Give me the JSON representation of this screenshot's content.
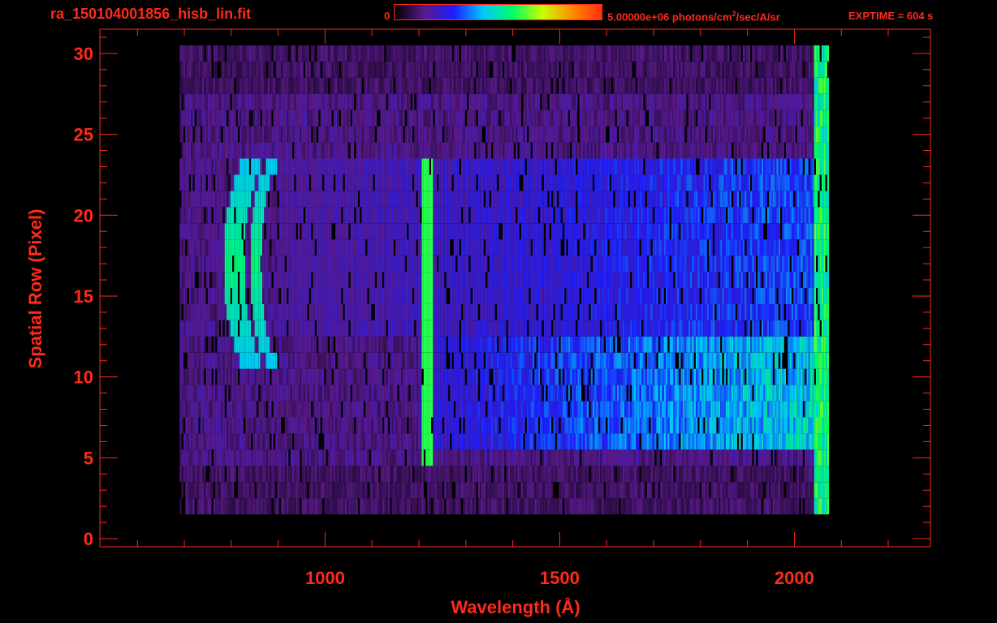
{
  "header": {
    "filename": "ra_150104001856_hisb_lin.fit",
    "colorbar_min_label": "0",
    "colorbar_max_label": "5.00000e+06 photons/cm",
    "colorbar_unit_exp": "2",
    "colorbar_unit_tail": "/sec/A/sr",
    "exptime_label": "EXPTIME = 604 s"
  },
  "colors": {
    "axis": "#ff2a1a",
    "background": "#000000",
    "colormap": [
      "#000000",
      "#5a1a8c",
      "#1e1eff",
      "#00c8ff",
      "#00ff64",
      "#c8ff00",
      "#ff8c00",
      "#ff3010"
    ]
  },
  "chart_data": {
    "type": "heatmap",
    "title": "ra_150104001856_hisb_lin.fit",
    "xlabel": "Wavelength (Å)",
    "ylabel": "Spatial Row (Pixel)",
    "xlim": [
      520,
      2290
    ],
    "ylim": [
      -0.5,
      31.5
    ],
    "x_ticks": [
      1000,
      1500,
      2000
    ],
    "x_minor_step": 100,
    "y_ticks": [
      0,
      5,
      10,
      15,
      20,
      25,
      30
    ],
    "y_minor_step": 1,
    "colorbar_range": [
      0,
      5000000
    ],
    "colorbar_unit": "photons/cm2/sec/A/sr",
    "exptime_s": 604,
    "data_extent": {
      "x": [
        690,
        2070
      ],
      "y": [
        2,
        30
      ]
    },
    "features": [
      {
        "name": "Lyman-alpha line",
        "x": 1216,
        "y_range": [
          5,
          23
        ],
        "level": 0.6
      },
      {
        "name": "arc",
        "x_range": [
          800,
          960
        ],
        "y_range": [
          11,
          23
        ],
        "level": 0.55
      },
      {
        "name": "bright band",
        "x_range": [
          1200,
          2060
        ],
        "y_range": [
          6,
          12
        ],
        "level": 0.42
      },
      {
        "name": "upper band",
        "x_range": [
          900,
          2060
        ],
        "y_range": [
          13,
          23
        ],
        "level": 0.3
      }
    ]
  }
}
